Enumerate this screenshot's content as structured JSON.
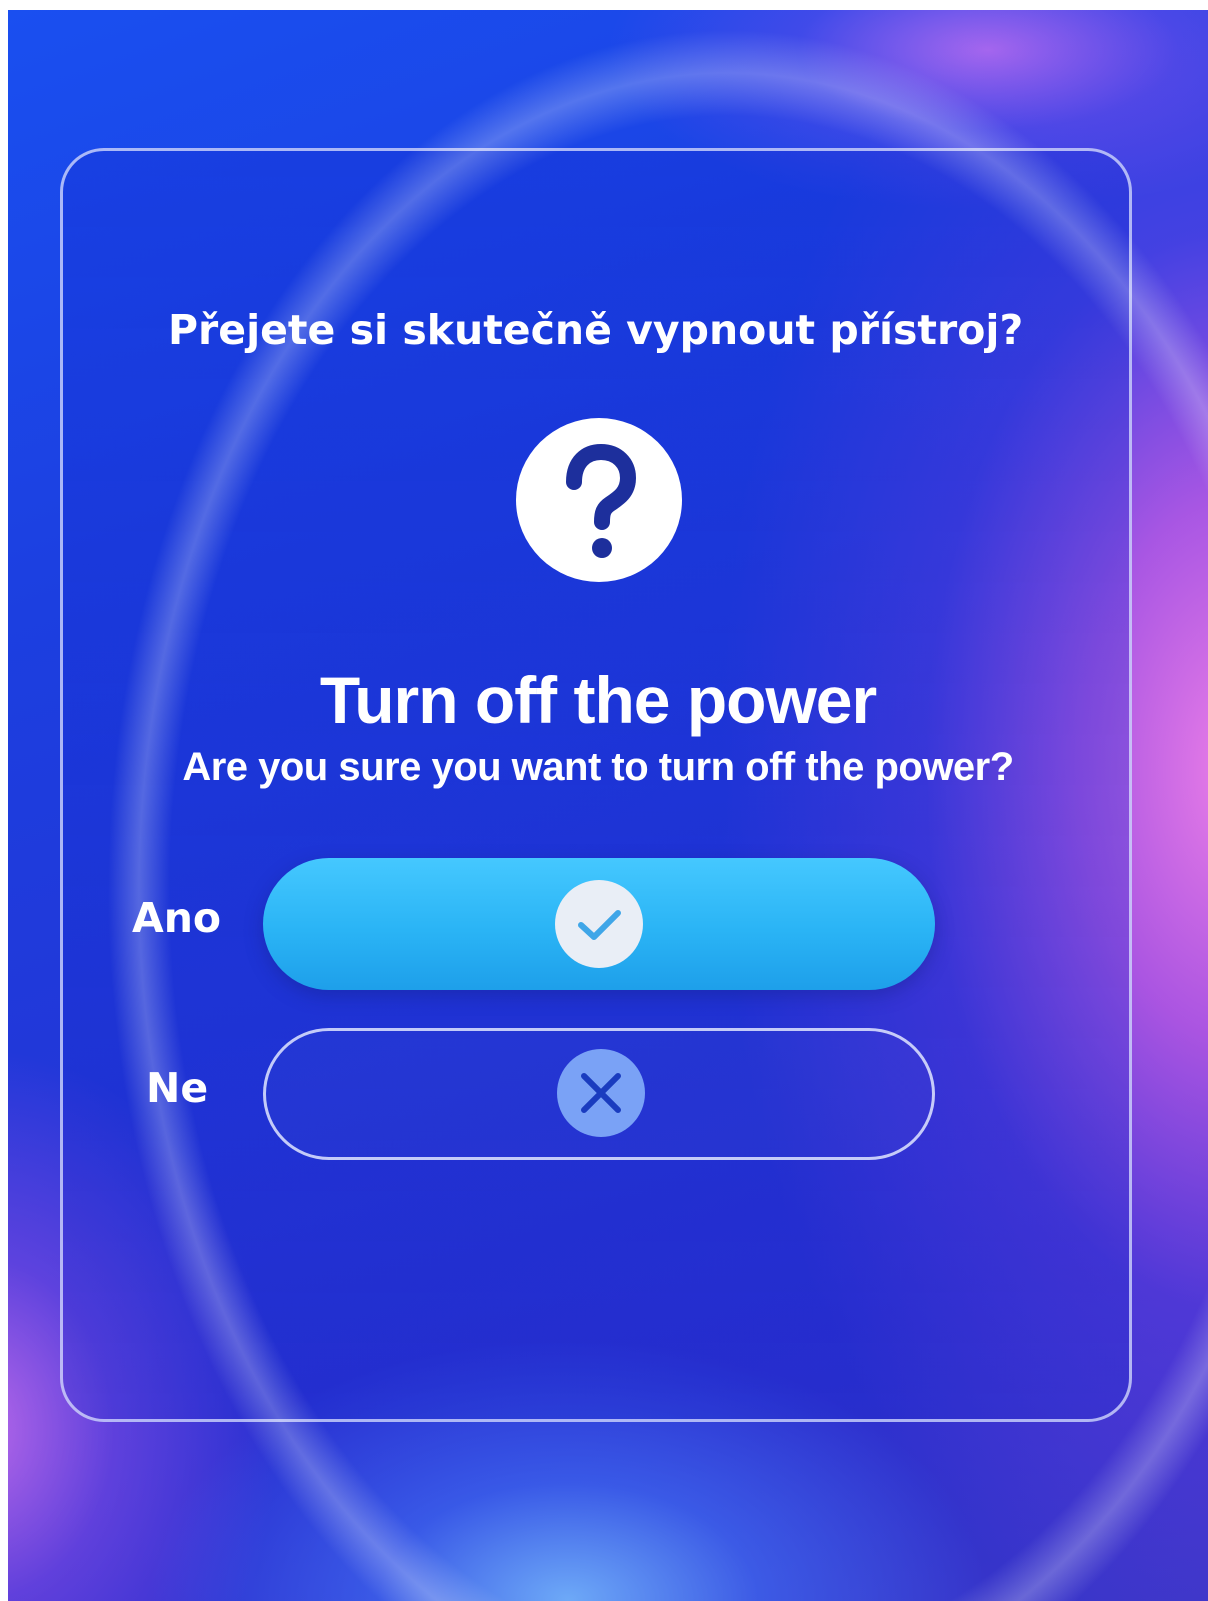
{
  "dialog": {
    "czech_prompt": "Přejete si skutečně vypnout přístroj?",
    "title": "Turn off the power",
    "subtitle": "Are you sure you want to turn off the power?",
    "header_icon": "question-mark-icon"
  },
  "options": {
    "yes": {
      "label": "Ano",
      "icon": "checkmark-icon",
      "color": "#2ab4f5"
    },
    "no": {
      "label": "Ne",
      "icon": "close-icon",
      "color": "#7aa2f6"
    }
  }
}
